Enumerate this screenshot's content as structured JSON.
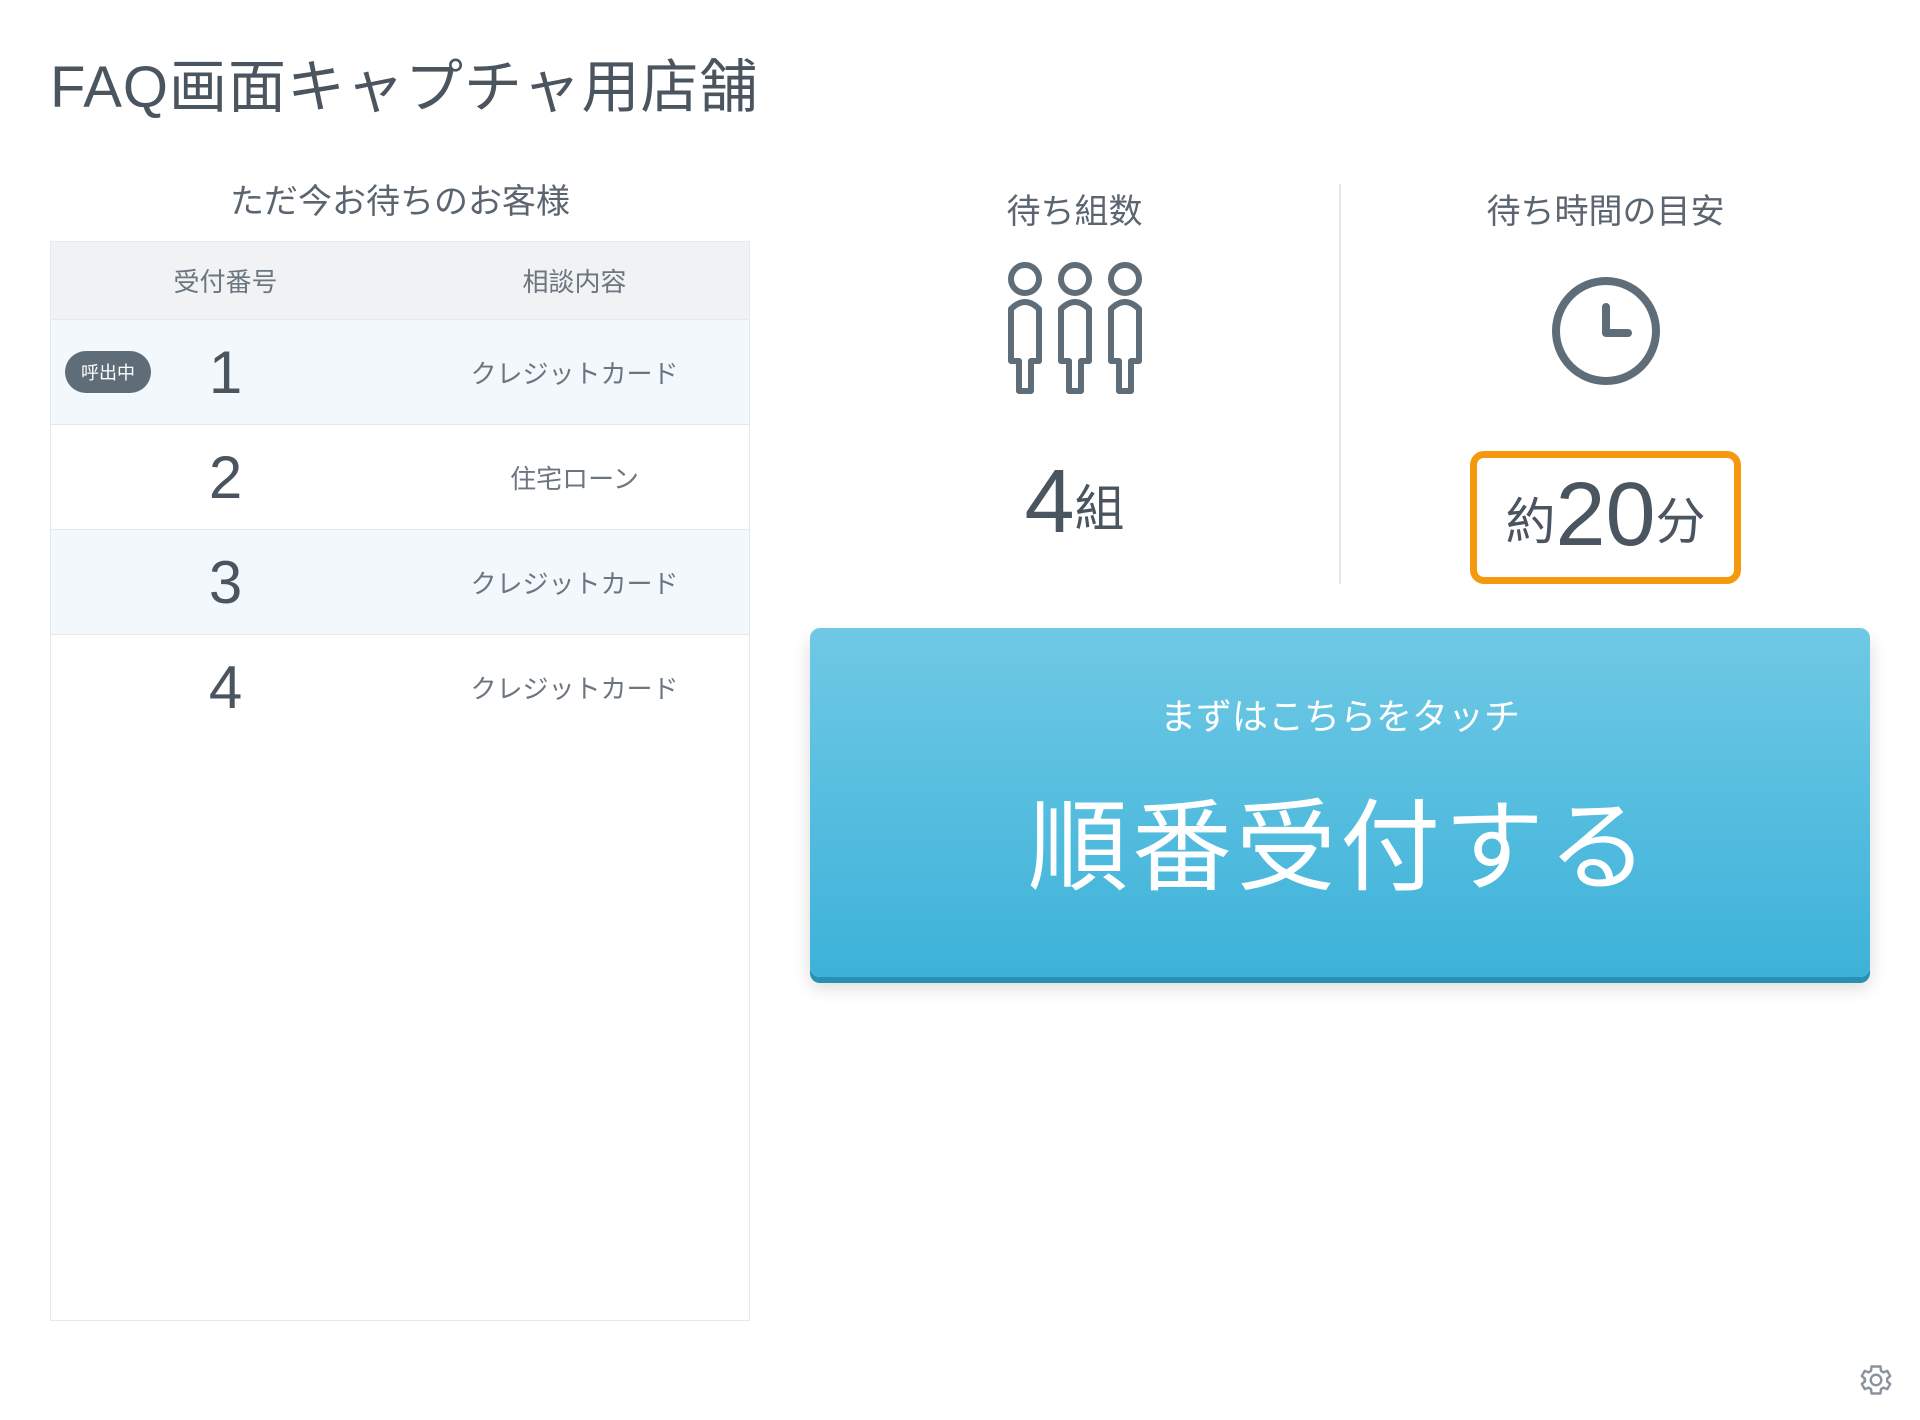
{
  "title": "FAQ画面キャプチャ用店舗",
  "queue": {
    "subtitle": "ただ今お待ちのお客様",
    "headers": {
      "number": "受付番号",
      "topic": "相談内容"
    },
    "badge_calling": "呼出中",
    "rows": [
      {
        "number": "1",
        "topic": "クレジットカード",
        "calling": true
      },
      {
        "number": "2",
        "topic": "住宅ローン",
        "calling": false
      },
      {
        "number": "3",
        "topic": "クレジットカード",
        "calling": false
      },
      {
        "number": "4",
        "topic": "クレジットカード",
        "calling": false
      }
    ]
  },
  "stats": {
    "groups": {
      "label": "待ち組数",
      "value_number": "4",
      "value_unit": "組"
    },
    "wait": {
      "label": "待ち時間の目安",
      "value_prefix": "約",
      "value_number": "20",
      "value_unit": "分"
    }
  },
  "cta": {
    "sub": "まずはこちらをタッチ",
    "main": "順番受付する"
  }
}
